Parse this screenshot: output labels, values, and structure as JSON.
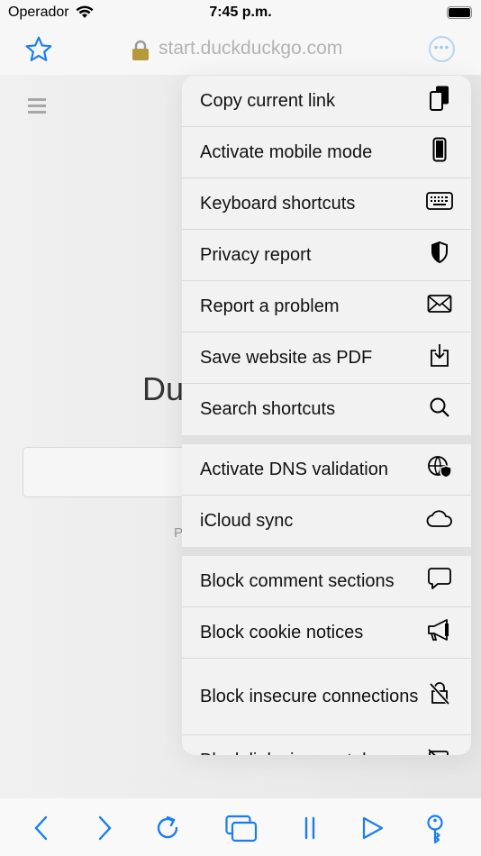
{
  "status": {
    "carrier": "Operador",
    "time": "7:45 p.m."
  },
  "urlbar": {
    "url": "start.duckduckgo.com"
  },
  "page": {
    "title_fragment": "Du",
    "footer_fragment": "P"
  },
  "menu": {
    "groups": [
      [
        {
          "label": "Copy current link",
          "icon": "copy-icon"
        },
        {
          "label": "Activate mobile mode",
          "icon": "phone-icon"
        },
        {
          "label": "Keyboard shortcuts",
          "icon": "keyboard-icon"
        },
        {
          "label": "Privacy report",
          "icon": "shield-icon"
        },
        {
          "label": "Report a problem",
          "icon": "envelope-icon"
        },
        {
          "label": "Save website as PDF",
          "icon": "download-icon"
        },
        {
          "label": "Search shortcuts",
          "icon": "search-icon"
        }
      ],
      [
        {
          "label": "Activate DNS validation",
          "icon": "globe-shield-icon"
        },
        {
          "label": "iCloud sync",
          "icon": "cloud-icon"
        }
      ],
      [
        {
          "label": "Block comment sections",
          "icon": "speech-bubble-icon"
        },
        {
          "label": "Block cookie notices",
          "icon": "megaphone-icon"
        },
        {
          "label": "Block insecure connections",
          "icon": "lock-slash-icon"
        },
        {
          "label": "Block links in new tabs",
          "icon": "tabs-slash-icon"
        }
      ]
    ]
  },
  "colors": {
    "accent": "#1a7cf5"
  }
}
